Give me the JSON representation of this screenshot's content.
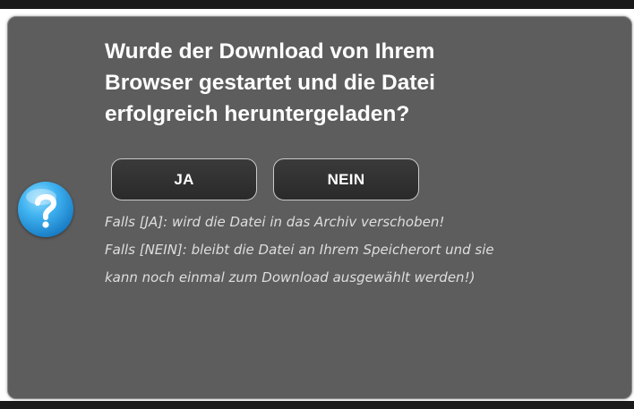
{
  "dialog": {
    "question_lines": [
      "Wurde der Download von Ihrem",
      "Browser gestartet und die Datei",
      "erfolgreich heruntergeladen?"
    ],
    "icon": "question-mark-icon",
    "buttons": {
      "yes_label": "JA",
      "no_label": "NEIN"
    },
    "info_lines": [
      "Falls [JA]: wird die Datei in das Archiv verschoben!",
      "Falls [NEIN]: bleibt die Datei an Ihrem Speicherort und sie",
      "kann noch einmal zum Download ausgewählt werden!)"
    ]
  },
  "colors": {
    "dialog_background": "#5d5d5d",
    "button_background": "#2f2f2f",
    "button_border": "#c9c9c9",
    "icon_blue": "#1f8fd8",
    "text_primary": "#ffffff",
    "text_secondary": "#dedede"
  }
}
